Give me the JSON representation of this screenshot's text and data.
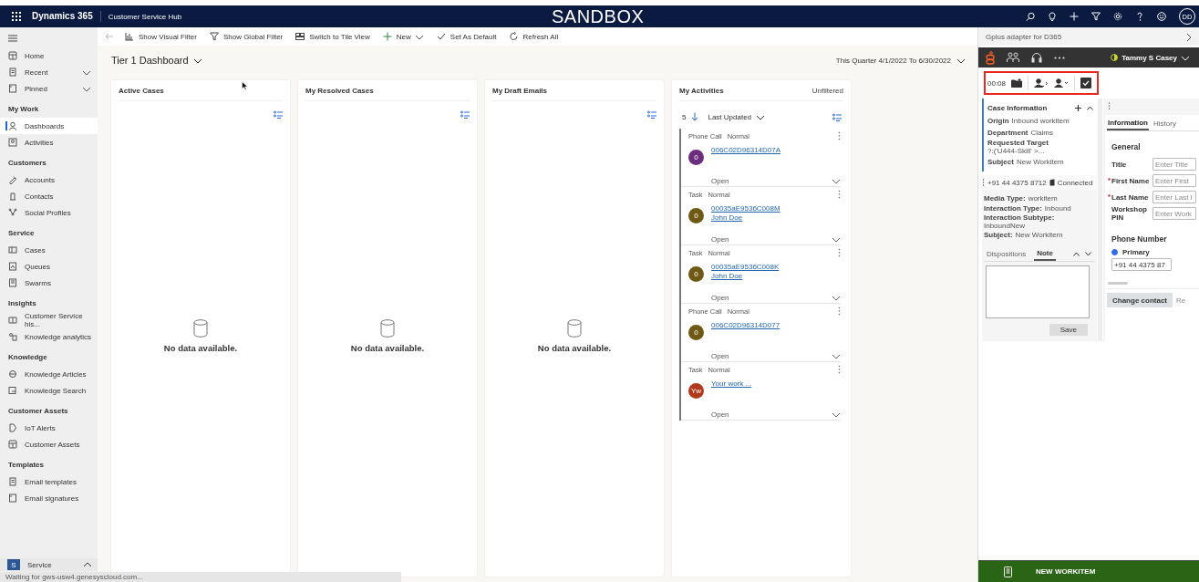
{
  "topbar": {
    "app_name": "Dynamics 365",
    "module": "Customer Service Hub",
    "environment": "SANDBOX",
    "avatar": "DD"
  },
  "sidebar": {
    "top_items": [
      {
        "label": "Home",
        "expandable": false
      },
      {
        "label": "Recent",
        "expandable": true
      },
      {
        "label": "Pinned",
        "expandable": true
      }
    ],
    "sections": [
      {
        "title": "My Work",
        "items": [
          {
            "label": "Dashboards",
            "selected": true
          },
          {
            "label": "Activities",
            "selected": false
          }
        ]
      },
      {
        "title": "Customers",
        "items": [
          {
            "label": "Accounts",
            "selected": false
          },
          {
            "label": "Contacts",
            "selected": false
          },
          {
            "label": "Social Profiles",
            "selected": false
          }
        ]
      },
      {
        "title": "Service",
        "items": [
          {
            "label": "Cases",
            "selected": false
          },
          {
            "label": "Queues",
            "selected": false
          },
          {
            "label": "Swarms",
            "selected": false
          }
        ]
      },
      {
        "title": "Insights",
        "items": [
          {
            "label": "Customer Service his...",
            "selected": false
          },
          {
            "label": "Knowledge analytics",
            "selected": false
          }
        ]
      },
      {
        "title": "Knowledge",
        "items": [
          {
            "label": "Knowledge Articles",
            "selected": false
          },
          {
            "label": "Knowledge Search",
            "selected": false
          }
        ]
      },
      {
        "title": "Customer Assets",
        "items": [
          {
            "label": "IoT Alerts",
            "selected": false
          },
          {
            "label": "Customer Assets",
            "selected": false
          }
        ]
      },
      {
        "title": "Templates",
        "items": [
          {
            "label": "Email templates",
            "selected": false
          },
          {
            "label": "Email signatures",
            "selected": false
          }
        ]
      }
    ],
    "area": {
      "badge": "S",
      "label": "Service"
    }
  },
  "command_bar": [
    {
      "kind": "chart",
      "label": "Show Visual Filter"
    },
    {
      "kind": "filter",
      "label": "Show Global Filter"
    },
    {
      "kind": "tile",
      "label": "Switch to Tile View"
    },
    {
      "kind": "new",
      "label": "New"
    },
    {
      "kind": "check",
      "label": "Set As Default"
    },
    {
      "kind": "refresh",
      "label": "Refresh All"
    }
  ],
  "dashboard": {
    "title": "Tier 1 Dashboard",
    "date_range": "This Quarter 4/1/2022 To 6/30/2022",
    "empty_cards": [
      {
        "title": "Active Cases",
        "message": "No data available."
      },
      {
        "title": "My Resolved Cases",
        "message": "No data available."
      },
      {
        "title": "My Draft Emails",
        "message": "No data available."
      }
    ],
    "activities": {
      "title": "My Activities",
      "filter": "Unfiltered",
      "count": "5",
      "sort": "Last Updated",
      "items": [
        {
          "type": "Phone Call",
          "priority": "Normal",
          "initials": "0",
          "color": "#6b2d7d",
          "subject": "006C02D96314D07A",
          "status": "Open"
        },
        {
          "type": "Task",
          "priority": "Normal",
          "initials": "0",
          "color": "#6e5a14",
          "subject": "00035aE9536C008M",
          "regarding": "John Doe",
          "status": "Open"
        },
        {
          "type": "Task",
          "priority": "Normal",
          "initials": "0",
          "color": "#6e5a14",
          "subject": "00035aE9536C008K",
          "regarding": "John Doe",
          "status": "Open"
        },
        {
          "type": "Phone Call",
          "priority": "Normal",
          "initials": "0",
          "color": "#6e5a14",
          "subject": "006C02D96314D077",
          "status": "Open"
        },
        {
          "type": "Task",
          "priority": "Normal",
          "initials": "Yw",
          "color": "#b2391c",
          "subject": "Your work ...",
          "status": "Open"
        }
      ]
    }
  },
  "adapter": {
    "header": "Gplus adapter for D365",
    "agent": "Tammy S Casey",
    "timer": "00:08",
    "case_info": {
      "title": "Case Information",
      "fields": [
        {
          "label": "Origin",
          "value": "Inbound workitem"
        },
        {
          "label": "Department",
          "value": "Claims"
        },
        {
          "label": "Requested Target",
          "value": "?:('U444-Skill' >..."
        },
        {
          "label": "Subject",
          "value": "New Workitem"
        }
      ]
    },
    "interaction": {
      "phone": "+91 44 4375 8712",
      "state": "Connected",
      "fields": [
        {
          "label": "Media Type:",
          "value": "workitem"
        },
        {
          "label": "Interaction Type:",
          "value": "Inbound"
        },
        {
          "label": "Interaction Subtype:",
          "value": "InboundNew"
        },
        {
          "label": "Subject:",
          "value": "New Workitem"
        }
      ],
      "tabs": [
        {
          "label": "Dispositions",
          "selected": false
        },
        {
          "label": "Note",
          "selected": true
        }
      ],
      "save": "Save"
    },
    "contact": {
      "tabs": [
        {
          "label": "Information",
          "selected": true
        },
        {
          "label": "History",
          "selected": false
        }
      ],
      "general": "General",
      "fields": [
        {
          "label": "Title",
          "required": false,
          "placeholder": "Enter Title"
        },
        {
          "label": "First Name",
          "required": true,
          "placeholder": "Enter First"
        },
        {
          "label": "Last Name",
          "required": true,
          "placeholder": "Enter Last l"
        },
        {
          "label": "Workshop PIN",
          "required": false,
          "placeholder": "Enter Work"
        }
      ],
      "phone_heading": "Phone Number",
      "phones": [
        {
          "label": "Primary",
          "selected": true,
          "value": "+91 44 4375 87"
        }
      ],
      "buttons": [
        "Change contact",
        "Re"
      ]
    },
    "footer": "NEW WORKITEM"
  },
  "status_bar": "Waiting for gws-usw4.genesyscloud.com..."
}
